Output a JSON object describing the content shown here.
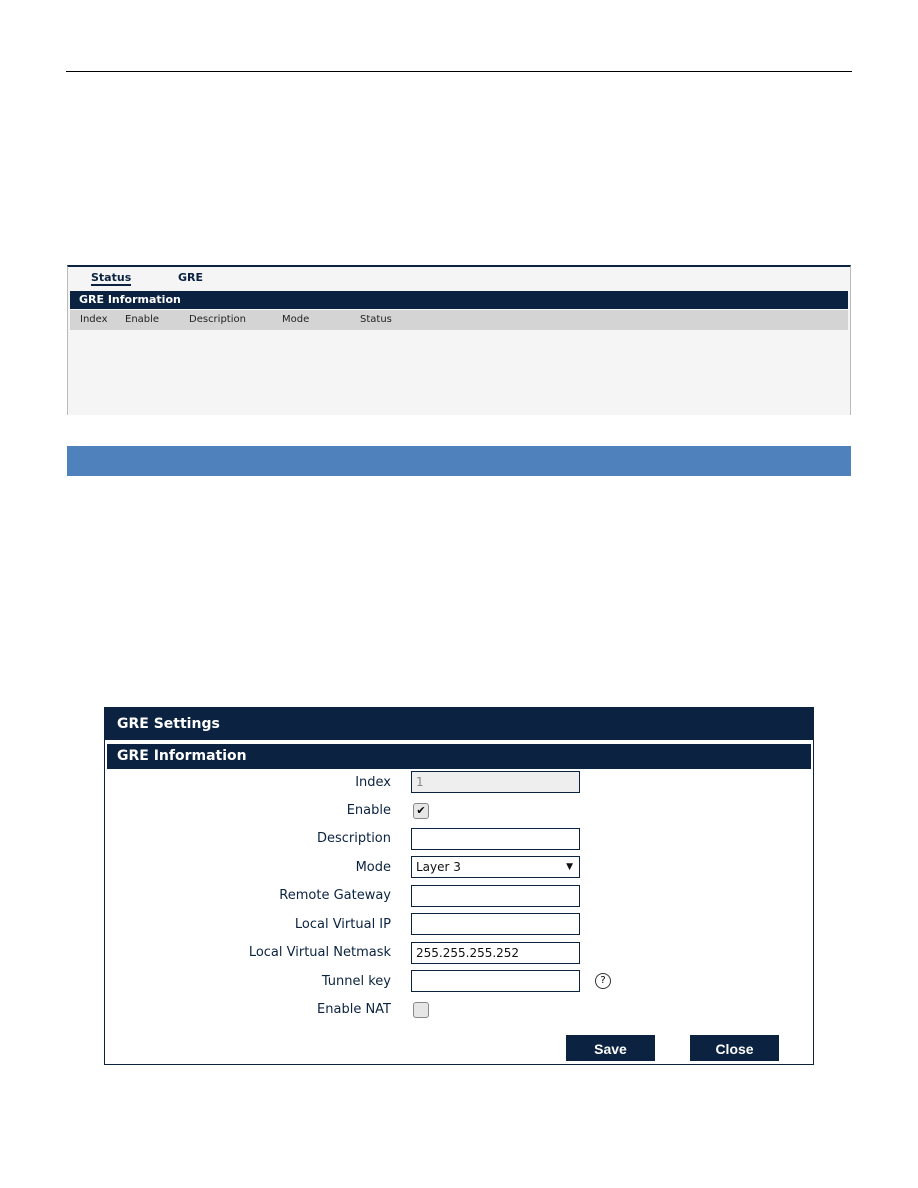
{
  "status_panel": {
    "tabs": [
      {
        "label": "Status"
      },
      {
        "label": "GRE"
      }
    ],
    "section_title": "GRE Information",
    "columns": [
      "Index",
      "Enable",
      "Description",
      "Mode",
      "Status"
    ]
  },
  "settings": {
    "title": "GRE Settings",
    "section_title": "GRE Information",
    "fields": {
      "index": {
        "label": "Index",
        "value": "1"
      },
      "enable": {
        "label": "Enable",
        "checked": true
      },
      "description": {
        "label": "Description",
        "value": ""
      },
      "mode": {
        "label": "Mode",
        "value": "Layer 3"
      },
      "remote_gateway": {
        "label": "Remote Gateway",
        "value": ""
      },
      "local_virtual_ip": {
        "label": "Local Virtual IP",
        "value": ""
      },
      "local_virtual_netmask": {
        "label": "Local Virtual Netmask",
        "value": "255.255.255.252"
      },
      "tunnel_key": {
        "label": "Tunnel key",
        "value": ""
      },
      "enable_nat": {
        "label": "Enable NAT",
        "checked": false
      }
    },
    "save_label": "Save",
    "close_label": "Close"
  },
  "colors": {
    "navy": "#0b2340",
    "accent_bar": "#4f81bd"
  }
}
